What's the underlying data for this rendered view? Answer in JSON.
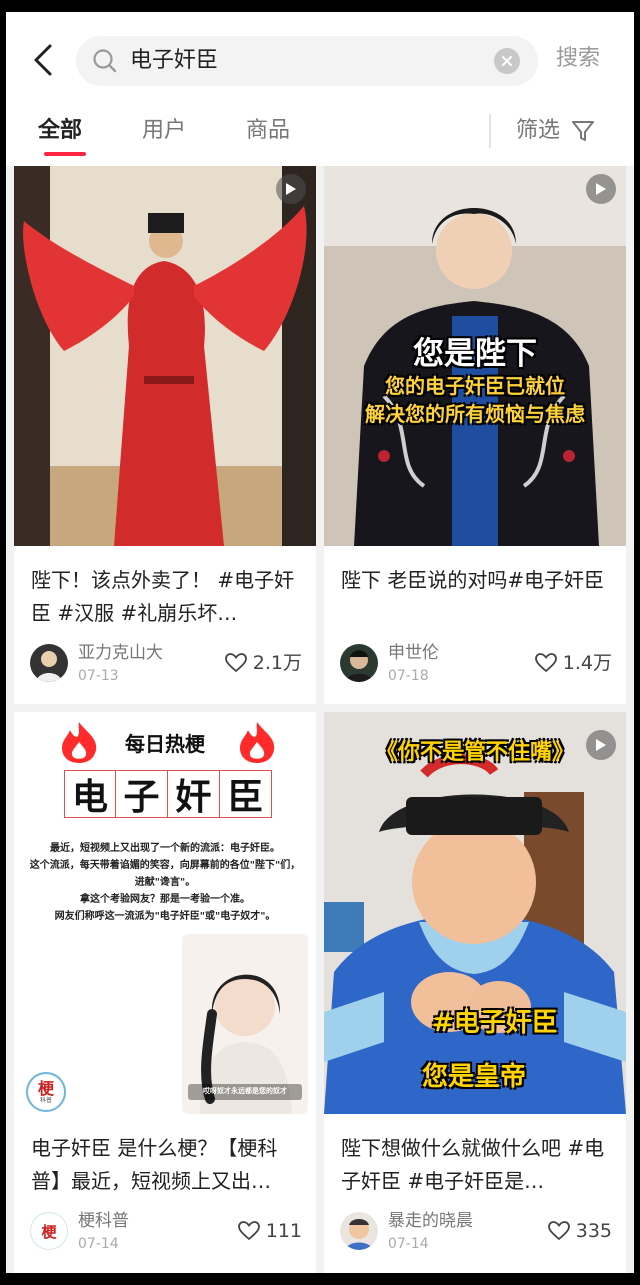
{
  "search": {
    "query": "电子奸臣",
    "button_label": "搜索"
  },
  "tabs": [
    {
      "label": "全部"
    },
    {
      "label": "用户"
    },
    {
      "label": "商品"
    }
  ],
  "filter": {
    "label": "筛选"
  },
  "colors": {
    "accent": "#ff2442"
  },
  "cards": [
    {
      "title": "陛下！该点外卖了！ #电子奸臣 #汉服 #礼崩乐坏…",
      "author": "亚力克山大",
      "date": "07-13",
      "likes": "2.1万",
      "is_video": true
    },
    {
      "title": "陛下 老臣说的对吗#电子奸臣",
      "author": "申世伦",
      "date": "07-18",
      "likes": "1.4万",
      "is_video": true,
      "overlay": {
        "line1": "您是陛下",
        "line2": "您的电子奸臣已就位",
        "line3": "解决您的所有烦恼与焦虑"
      }
    },
    {
      "title": "电子奸臣 是什么梗？【梗科普】最近，短视频上又出…",
      "author": "梗科普",
      "date": "07-14",
      "likes": "111",
      "is_video": false,
      "overlay": {
        "header": "每日热梗",
        "term_chars": [
          "电",
          "子",
          "奸",
          "臣"
        ],
        "lines": [
          "最近，短视频上又出现了一个新的流派：电子奸臣。",
          "这个流派，每天带着谄媚的笑容，向屏幕前的各位\"陛下\"们，",
          "进献\"谗言\"。",
          "拿这个考验网友？那是一考验一个准。",
          "网友们称呼这一流派为\"电子奸臣\"或\"电子奴才\"。"
        ],
        "subtitle": "哎呀奴才永远都是您的奴才",
        "logo_char": "梗",
        "logo_sub": "科普"
      }
    },
    {
      "title": "陛下想做什么就做什么吧 #电子奸臣 #电子奸臣是…",
      "author": "暴走的晓晨",
      "date": "07-14",
      "likes": "335",
      "is_video": true,
      "overlay": {
        "top": "《你不是管不住嘴》",
        "tag": "#电子奸臣",
        "bottom": "您是皇帝"
      }
    }
  ]
}
